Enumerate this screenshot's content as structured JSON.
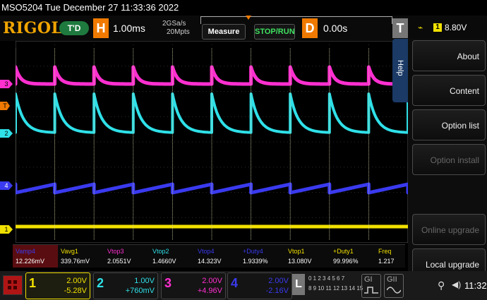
{
  "status": {
    "text": "MSO5204  Tue December 27 11:33:36 2022"
  },
  "toolbar": {
    "brand": "RIGOL",
    "trigger_state": "T'D",
    "horizontal_key": "H",
    "timebase": "1.00ms",
    "sample_rate": "2GSa/s",
    "memory_depth": "20Mpts",
    "measure_label": "Measure",
    "run_label": "STOP/RUN",
    "delay_key": "D",
    "delay_value": "0.00s",
    "trigger_key": "T",
    "trigger_channel": "1",
    "trigger_level": "8.80V"
  },
  "help_tab": "Help",
  "help_menu": [
    {
      "label": "About",
      "enabled": true
    },
    {
      "label": "Content",
      "enabled": true
    },
    {
      "label": "Option list",
      "enabled": true
    },
    {
      "label": "Option install",
      "enabled": false
    },
    {
      "label": "Online upgrade",
      "enabled": false
    },
    {
      "label": "Local upgrade",
      "enabled": true
    }
  ],
  "channel_markers": [
    "3",
    "T",
    "2",
    "4",
    "1"
  ],
  "measurements": [
    {
      "label": "Vamp4",
      "value": "12.226mV",
      "color": "#3a3af0"
    },
    {
      "label": "Vavg1",
      "value": "339.76mV",
      "color": "#f0e000"
    },
    {
      "label": "Vtop3",
      "value": "2.0551V",
      "color": "#ff2fd0"
    },
    {
      "label": "Vtop2",
      "value": "1.4660V",
      "color": "#2fe0e8"
    },
    {
      "label": "Vtop4",
      "value": "14.323V",
      "color": "#3a3af0"
    },
    {
      "label": "+Duty4",
      "value": "1.9339%",
      "color": "#3a3af0"
    },
    {
      "label": "Vtop1",
      "value": "13.080V",
      "color": "#f0e000"
    },
    {
      "label": "+Duty1",
      "value": "99.996%",
      "color": "#f0e000"
    },
    {
      "label": "Freq",
      "value": "1.217",
      "color": "#f0e000"
    }
  ],
  "channels": [
    {
      "num": "1",
      "scale": "2.00V",
      "offset": "-5.28V",
      "color": "#f0e000"
    },
    {
      "num": "2",
      "scale": "1.00V",
      "offset": "+760mV",
      "color": "#2fe0e8"
    },
    {
      "num": "3",
      "scale": "2.00V",
      "offset": "+4.96V",
      "color": "#ff2fd0"
    },
    {
      "num": "4",
      "scale": "2.00V",
      "offset": "-2.16V",
      "color": "#3a3af0"
    }
  ],
  "logic": {
    "key": "L",
    "row1": "0 1 2 3 4 5 6 7",
    "row2": "8 9 10 11 12 13 14 15"
  },
  "gens": [
    "GI",
    "GII"
  ],
  "clock": "11:32"
}
